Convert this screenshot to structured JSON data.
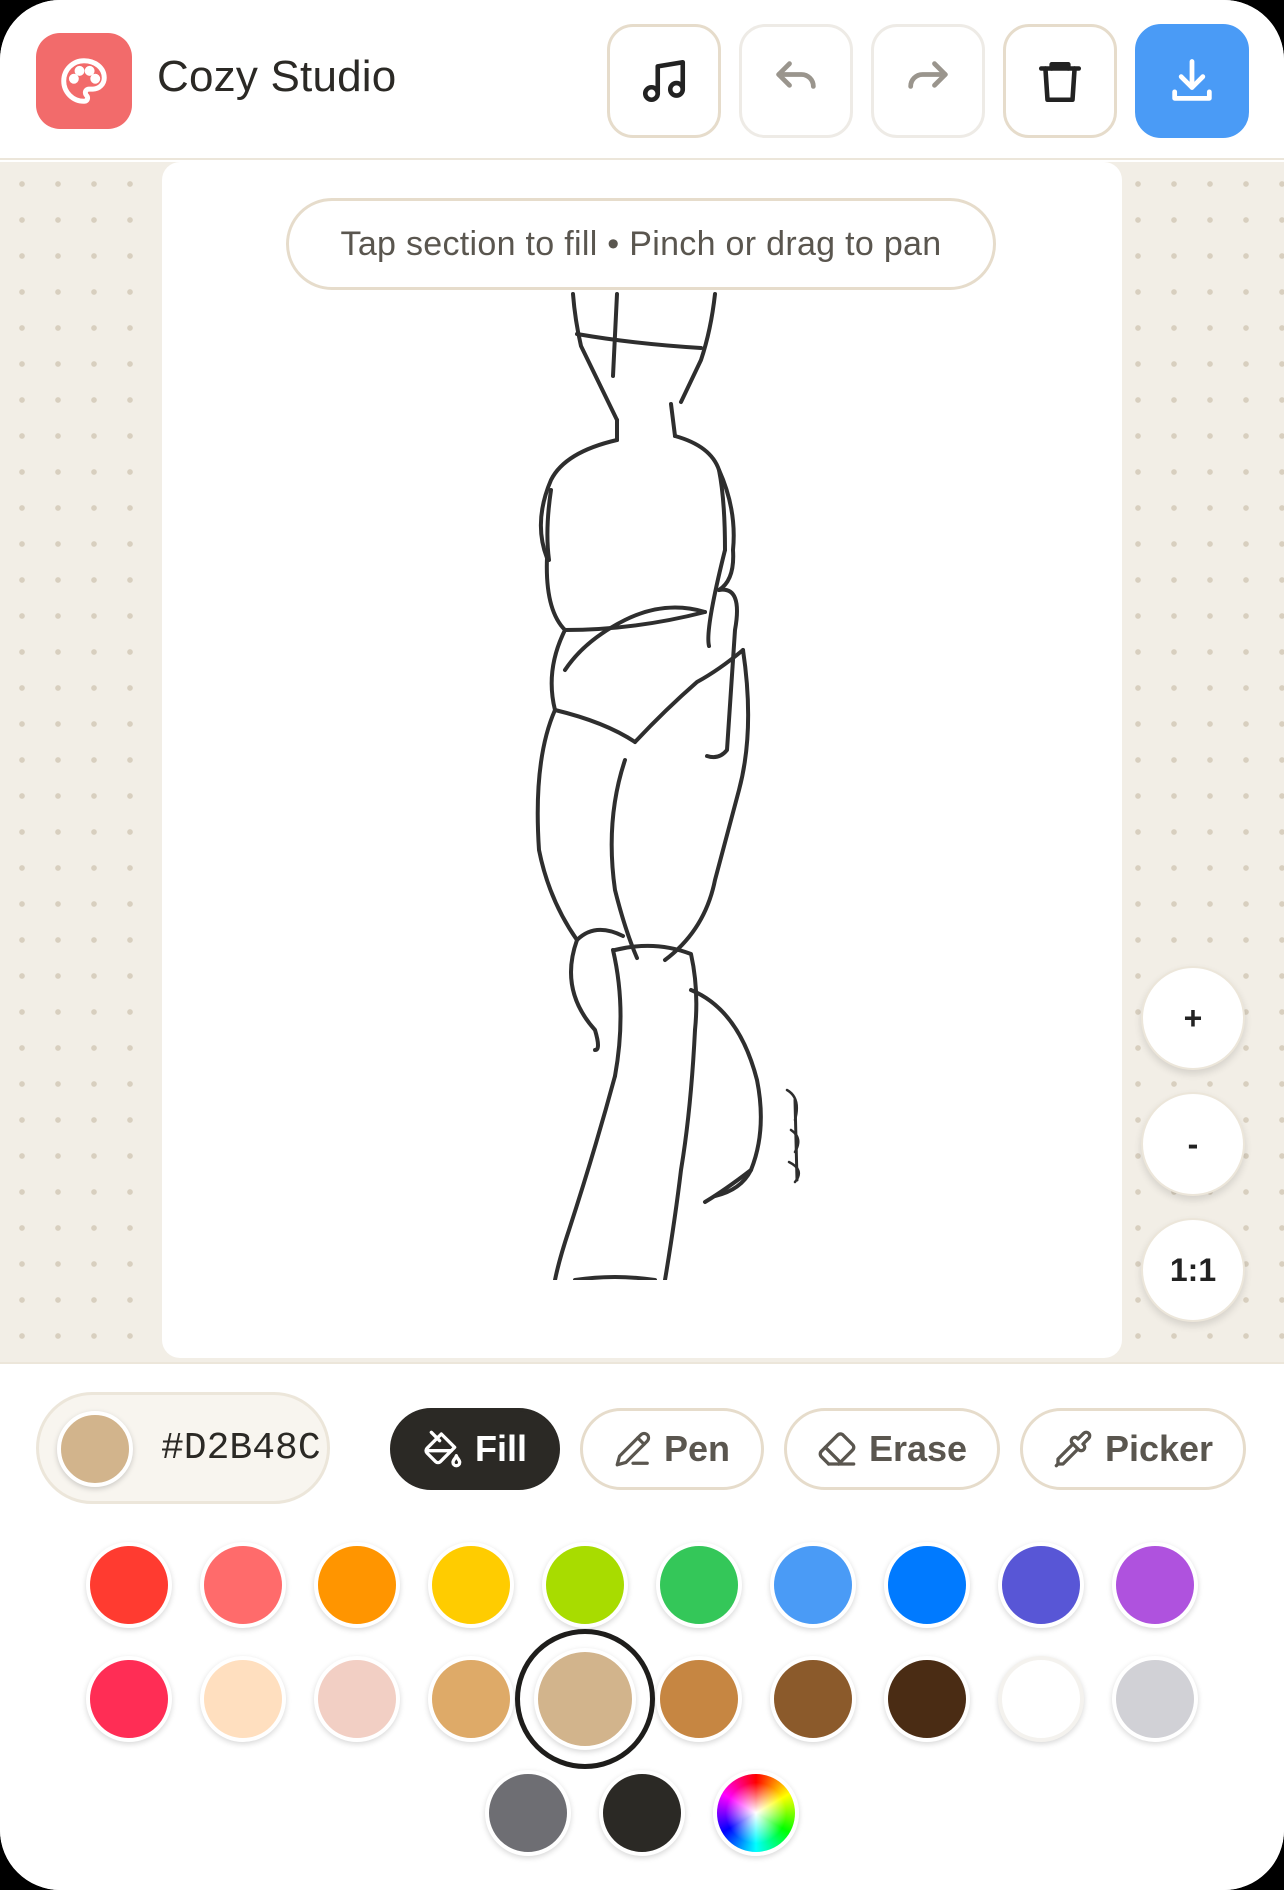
{
  "header": {
    "title": "Cozy Studio",
    "buttons": [
      "music",
      "undo",
      "redo",
      "clear",
      "download"
    ]
  },
  "canvas": {
    "hint": "Tap section to fill • Pinch or drag to pan"
  },
  "zoom": {
    "in_label": "+",
    "out_label": "-",
    "reset_label": "1:1"
  },
  "current_color": {
    "hex": "#D2B48C"
  },
  "tools": [
    {
      "label": "Fill",
      "icon": "paint-bucket-icon",
      "active": true
    },
    {
      "label": "Pen",
      "icon": "pen-icon",
      "active": false
    },
    {
      "label": "Erase",
      "icon": "eraser-icon",
      "active": false
    },
    {
      "label": "Picker",
      "icon": "eyedropper-icon",
      "active": false
    }
  ],
  "palette": {
    "row1": [
      "#FF3B30",
      "#FF6B6B",
      "#FF9500",
      "#FFCC00",
      "#A8DC00",
      "#34C759",
      "#4A9BF6",
      "#007AFF",
      "#5856D6",
      "#AF52DE"
    ],
    "row2": [
      "#FF2D55",
      "#FFDFBF",
      "#F2CFC4",
      "#DEAA68",
      "#D2B48C",
      "#C68642",
      "#8B5A2B",
      "#4A2C14",
      "#FFFFFF",
      "#D1D1D6"
    ],
    "row3": [
      "#6E6E73",
      "#2B2925",
      "rainbow"
    ],
    "selected": "#D2B48C"
  },
  "colors": {
    "accent": "#4A9BF6",
    "logo": "#F26B6B",
    "dark": "#2B2925"
  }
}
